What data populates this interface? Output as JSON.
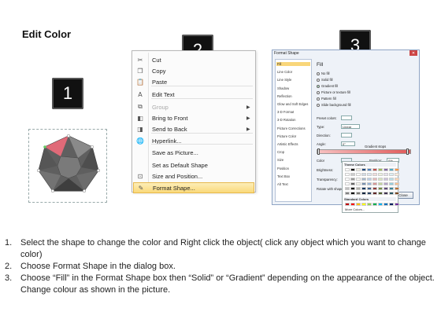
{
  "title": "Edit Color",
  "badges": [
    "1",
    "2",
    "3"
  ],
  "context_menu": {
    "items": [
      {
        "label": "Cut",
        "icon": "scissors-icon",
        "glyph": "✂",
        "disabled": false,
        "arrow": false
      },
      {
        "label": "Copy",
        "icon": "copy-icon",
        "glyph": "❐",
        "disabled": false,
        "arrow": false
      },
      {
        "label": "Paste",
        "icon": "paste-icon",
        "glyph": "📋",
        "disabled": false,
        "arrow": false
      },
      {
        "label": "Edit Text",
        "icon": "edit-text-icon",
        "glyph": "A",
        "disabled": false,
        "arrow": false
      },
      {
        "label": "Group",
        "icon": "group-icon",
        "glyph": "⧉",
        "disabled": true,
        "arrow": true
      },
      {
        "label": "Bring to Front",
        "icon": "bring-front-icon",
        "glyph": "◧",
        "disabled": false,
        "arrow": true
      },
      {
        "label": "Send to Back",
        "icon": "send-back-icon",
        "glyph": "◨",
        "disabled": false,
        "arrow": true
      },
      {
        "label": "Hyperlink...",
        "icon": "hyperlink-icon",
        "glyph": "🌐",
        "disabled": false,
        "arrow": false
      },
      {
        "label": "Save as Picture...",
        "icon": "",
        "glyph": "",
        "disabled": false,
        "arrow": false
      },
      {
        "label": "Set as Default Shape",
        "icon": "",
        "glyph": "",
        "disabled": false,
        "arrow": false
      },
      {
        "label": "Size and Position...",
        "icon": "size-position-icon",
        "glyph": "⊡",
        "disabled": false,
        "arrow": false
      },
      {
        "label": "Format Shape...",
        "icon": "format-shape-icon",
        "glyph": "✎",
        "disabled": false,
        "arrow": false,
        "highlight": true
      }
    ]
  },
  "dialog": {
    "title": "Format Shape",
    "close_glyph": "✕",
    "categories": [
      "Fill",
      "Line Color",
      "Line Style",
      "Shadow",
      "Reflection",
      "Glow and Soft Edges",
      "3-D Format",
      "3-D Rotation",
      "Picture Corrections",
      "Picture Color",
      "Artistic Effects",
      "Crop",
      "Size",
      "Position",
      "Text Box",
      "Alt Text"
    ],
    "selected_category": "Fill",
    "section_heading": "Fill",
    "fill_options": [
      {
        "label": "No fill",
        "selected": false
      },
      {
        "label": "Solid fill",
        "selected": false
      },
      {
        "label": "Gradient fill",
        "selected": true
      },
      {
        "label": "Picture or texture fill",
        "selected": false
      },
      {
        "label": "Pattern fill",
        "selected": false
      },
      {
        "label": "Slide background fill",
        "selected": false
      }
    ],
    "preset_colors_label": "Preset colors:",
    "type_label": "Type:",
    "type_value": "Linear",
    "direction_label": "Direction:",
    "angle_label": "Angle:",
    "angle_value": "0°",
    "gradient_stops_label": "Gradient stops",
    "color_label": "Color",
    "position_label": "Position:",
    "position_value": "0%",
    "brightness_label": "Brightness:",
    "transparency_label": "Transparency:",
    "rotate_label": "Rotate with shape",
    "close_label": "Close"
  },
  "palette": {
    "theme_heading": "Theme Colors",
    "standard_heading": "Standard Colors",
    "more_label": "More Colors...",
    "theme_top": [
      "#ffffff",
      "#000000",
      "#eeece1",
      "#1f497d",
      "#4f81bd",
      "#c0504d",
      "#9bbb59",
      "#8064a2",
      "#4bacc6",
      "#f79646"
    ],
    "standard": [
      "#c00000",
      "#ff0000",
      "#ffc000",
      "#ffff00",
      "#92d050",
      "#00b050",
      "#00b0f0",
      "#0070c0",
      "#002060",
      "#7030a0"
    ]
  },
  "steps": [
    {
      "n": "1.",
      "text": "Select the shape to change the color and Right click the object( click any object which you want to change color)"
    },
    {
      "n": "2.",
      "text": "Choose Format Shape in the dialog box."
    },
    {
      "n": "3.",
      "text": "Choose “Fill” in the Format Shape box then “Solid” or “Gradient” depending on the appearance of the object. Change colour as shown in the picture."
    }
  ]
}
